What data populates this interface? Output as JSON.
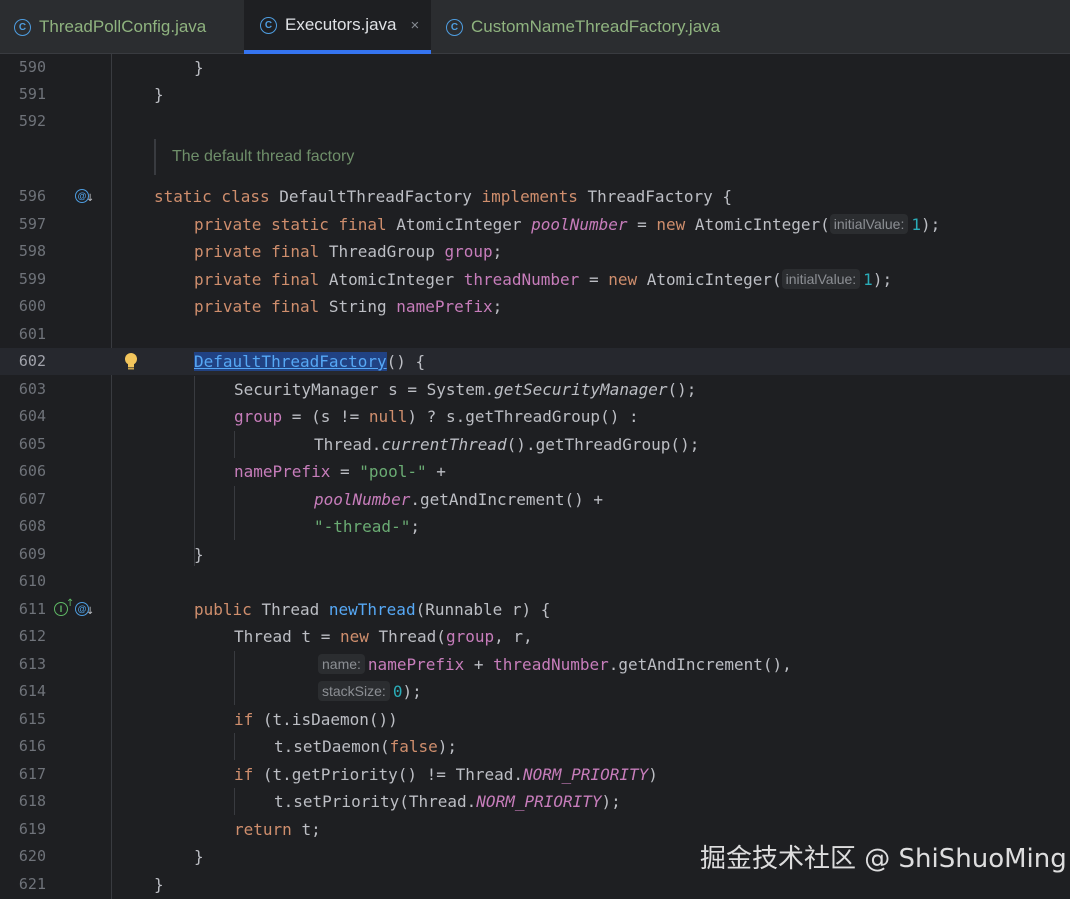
{
  "tabs": [
    {
      "label": "ThreadPollConfig.java",
      "active": false
    },
    {
      "label": "Executors.java",
      "active": true,
      "close": "×"
    },
    {
      "label": "CustomNameThreadFactory.java",
      "active": false
    }
  ],
  "editor": {
    "doc_comment": "The default thread factory",
    "current_line": "602",
    "line_numbers": [
      "590",
      "591",
      "592",
      "596",
      "597",
      "598",
      "599",
      "600",
      "601",
      "602",
      "603",
      "604",
      "605",
      "606",
      "607",
      "608",
      "609",
      "610",
      "611",
      "612",
      "613",
      "614",
      "615",
      "616",
      "617",
      "618",
      "619",
      "620",
      "621"
    ],
    "tokens": {
      "t590": "}",
      "t591": "}",
      "t596a": "static class ",
      "t596b": "DefaultThreadFactory ",
      "t596c": "implements ",
      "t596d": "ThreadFactory {",
      "t597a": "private static final ",
      "t597b": "AtomicInteger ",
      "t597c": "poolNumber",
      "t597d": " = ",
      "t597e": "new ",
      "t597f": "AtomicInteger(",
      "t597h": "initialValue:",
      "t597g": "1",
      "t597i": ");",
      "t598a": "private final ",
      "t598b": "ThreadGroup ",
      "t598c": "group",
      "t598d": ";",
      "t599a": "private final ",
      "t599b": "AtomicInteger ",
      "t599c": "threadNumber",
      "t599d": " = ",
      "t599e": "new ",
      "t599f": "AtomicInteger(",
      "t599h": "initialValue:",
      "t599g": "1",
      "t599i": ");",
      "t600a": "private final ",
      "t600b": "String ",
      "t600c": "namePrefix",
      "t600d": ";",
      "t602a": "DefaultThreadFactory",
      "t602b": "() {",
      "t603a": "SecurityManager s = System.",
      "t603b": "getSecurityManager",
      "t603c": "();",
      "t604a": "group",
      "t604b": " = (s != ",
      "t604c": "null",
      "t604d": ") ? s.getThreadGroup() :",
      "t605a": "Thread.",
      "t605b": "currentThread",
      "t605c": "().getThreadGroup();",
      "t606a": "namePrefix",
      "t606b": " = ",
      "t606c": "\"pool-\"",
      "t606d": " +",
      "t607a": "poolNumber",
      "t607b": ".getAndIncrement() +",
      "t608a": "\"-thread-\"",
      "t608b": ";",
      "t609": "}",
      "t611a": "public ",
      "t611b": "Thread ",
      "t611c": "newThread",
      "t611d": "(Runnable r) {",
      "t612a": "Thread t = ",
      "t612b": "new ",
      "t612c": "Thread(",
      "t612d": "group",
      "t612e": ", r,",
      "t613h": "name:",
      "t613a": "namePrefix",
      "t613b": " + ",
      "t613c": "threadNumber",
      "t613d": ".getAndIncrement(),",
      "t614h": "stackSize:",
      "t614a": "0",
      "t614b": ");",
      "t615a": "if ",
      "t615b": "(t.isDaemon())",
      "t616a": "t.setDaemon(",
      "t616b": "false",
      "t616c": ");",
      "t617a": "if ",
      "t617b": "(t.getPriority() != Thread.",
      "t617c": "NORM_PRIORITY",
      "t617d": ")",
      "t618a": "t.setPriority(Thread.",
      "t618b": "NORM_PRIORITY",
      "t618c": ");",
      "t619a": "return ",
      "t619b": "t;",
      "t620": "}",
      "t621": "}"
    }
  },
  "gutter_icons": {
    "implements_icon": "@",
    "override_icon": "I",
    "arrow_down": "↓",
    "arrow_up": "↑"
  },
  "watermark": "掘金技术社区 @ ShiShuoMing",
  "colors": {
    "background": "#1e1f22",
    "keyword": "#cf8e6d",
    "field": "#c77dbb",
    "string": "#6aab73",
    "number": "#2aacb8",
    "method": "#56a8f5"
  }
}
